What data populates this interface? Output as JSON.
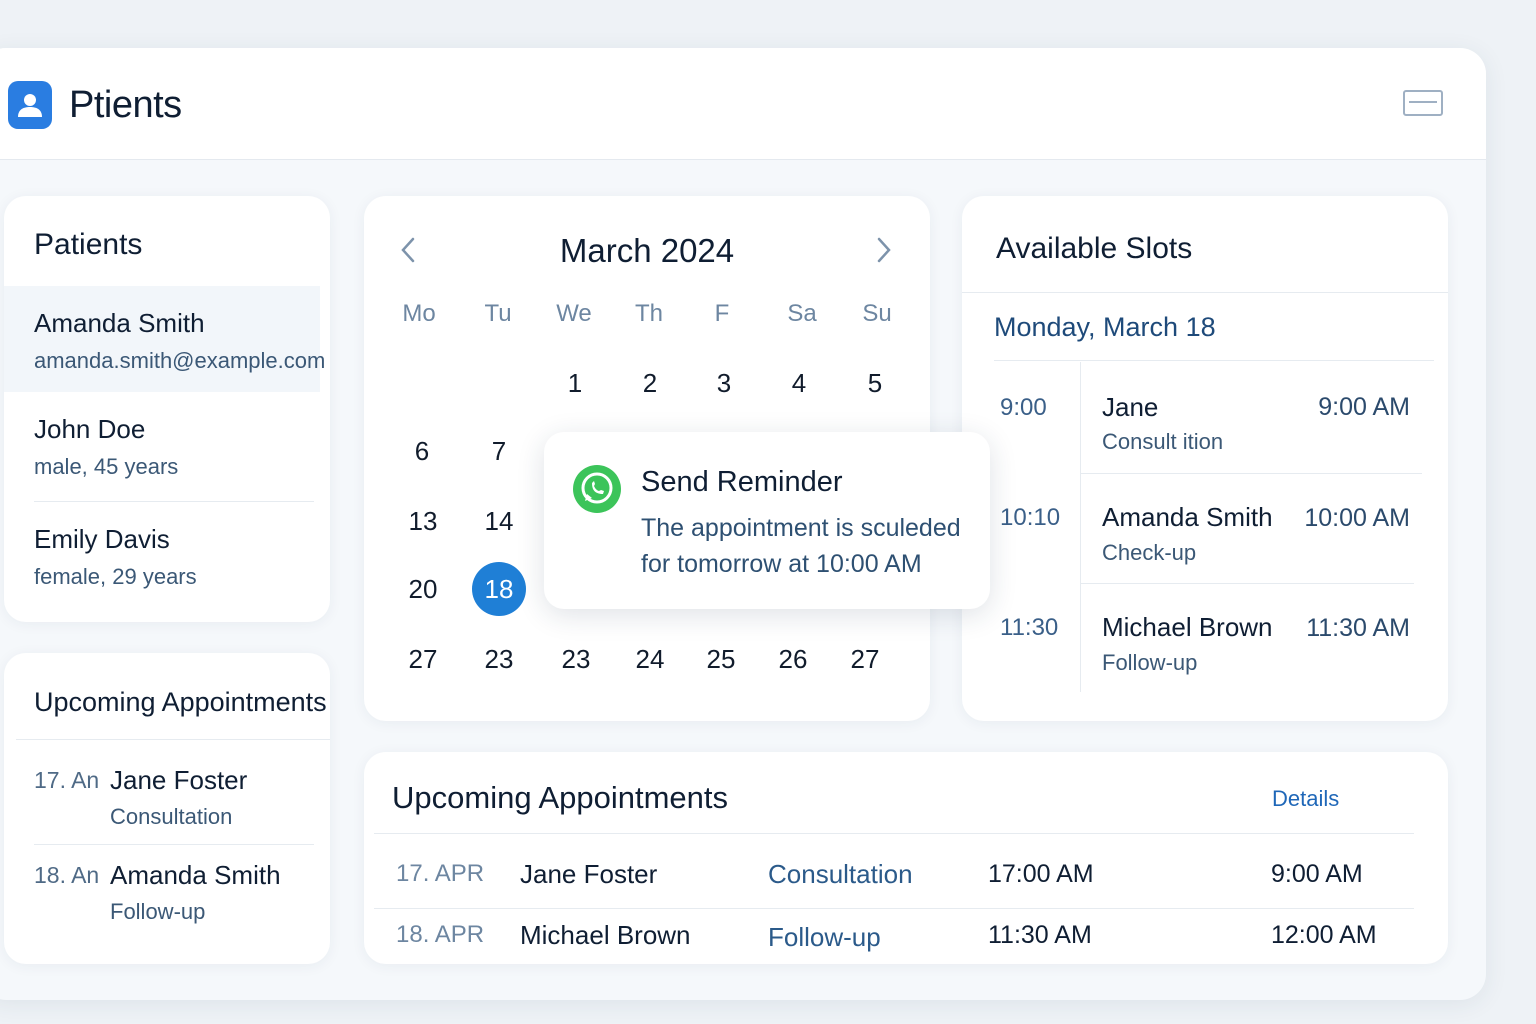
{
  "app": {
    "title": "Ptients",
    "icon": "user-icon"
  },
  "patients": {
    "title": "Patients",
    "items": [
      {
        "name": "Amanda Smith",
        "sub": "amanda.smith@example.com"
      },
      {
        "name": "John Doe",
        "sub": "male, 45 years"
      },
      {
        "name": "Emily Davis",
        "sub": "female, 29 years"
      }
    ]
  },
  "upcoming_small": {
    "title": "Upcoming Appointments",
    "items": [
      {
        "date": "17. An",
        "name": "Jane Foster",
        "type": "Consultation"
      },
      {
        "date": "18. An",
        "name": "Amanda Smith",
        "type": "Follow-up"
      }
    ]
  },
  "calendar": {
    "title": "March 2024",
    "prev_icon": "chevron-left-icon",
    "next_icon": "chevron-right-icon",
    "days_of_week": [
      "Mo",
      "Tu",
      "We",
      "Th",
      "F",
      "Sa",
      "Su"
    ],
    "row1": [
      "1",
      "2",
      "3",
      "4",
      "5"
    ],
    "row2": [
      "6",
      "7"
    ],
    "row3": [
      "13",
      "14"
    ],
    "row4": [
      "20",
      "18"
    ],
    "row5": [
      "27",
      "23",
      "23",
      "24",
      "25",
      "26",
      "27"
    ],
    "selected_day": "18"
  },
  "reminder": {
    "icon": "whatsapp-icon",
    "title": "Send Reminder",
    "text": "The appointment is sculeded for tomorrow at 10:00 AM"
  },
  "slots": {
    "title": "Available Slots",
    "day": "Monday, March 18",
    "items": [
      {
        "time": "9:00",
        "name": "Jane",
        "type": "Consult ition",
        "right": "9:00 AM"
      },
      {
        "time": "10:10",
        "name": "Amanda Smith",
        "type": "Check-up",
        "right": "10:00 AM"
      },
      {
        "time": "11:30",
        "name": "Michael Brown",
        "type": "Follow-up",
        "right": "11:30 AM"
      }
    ]
  },
  "upcoming_wide": {
    "title": "Upcoming Appointments",
    "details_label": "Details",
    "rows": [
      {
        "date": "17.  APR",
        "name": "Jane Foster",
        "type": "Consultation",
        "time1": "17:00 AM",
        "time2": "9:00 AM"
      },
      {
        "date": "18.  APR",
        "name": "Michael Brown",
        "type": "Follow-up",
        "time1": "11:30 AM",
        "time2": "12:00 AM"
      }
    ]
  },
  "colors": {
    "accent": "#1f7fd6",
    "brand_icon": "#2a7de1",
    "whatsapp": "#3cc45a"
  }
}
